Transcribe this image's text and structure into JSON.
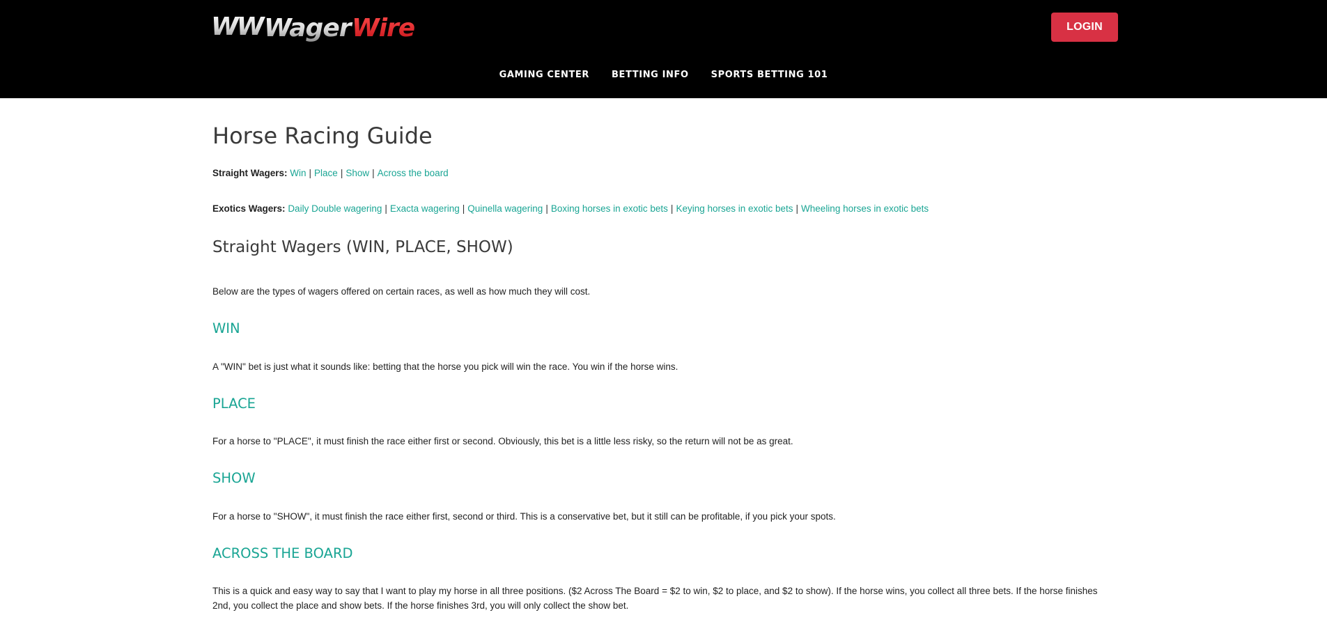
{
  "header": {
    "logo_text_wager": "Wager",
    "logo_text_wire": "Wire",
    "logo_mark": "WW",
    "login_label": "LOGIN",
    "nav": [
      {
        "label": "GAMING CENTER"
      },
      {
        "label": "BETTING INFO"
      },
      {
        "label": "SPORTS BETTING 101"
      }
    ]
  },
  "colors": {
    "header_bg": "#000000",
    "login_bg": "#d83144",
    "accent_teal": "#1aa594",
    "logo_red": "#e21d23"
  },
  "page": {
    "title": "Horse Racing Guide",
    "straight_label": "Straight Wagers:",
    "straight_links": [
      "Win",
      "Place",
      "Show",
      "Across the board"
    ],
    "exotics_label": "Exotics Wagers:",
    "exotics_links": [
      "Daily Double wagering",
      "Exacta wagering",
      "Quinella wagering",
      "Boxing horses in exotic bets",
      "Keying horses in exotic bets",
      "Wheeling horses in exotic bets"
    ],
    "section_title": "Straight Wagers (WIN, PLACE, SHOW)",
    "intro": "Below are the types of wagers offered on certain races, as well as how much they will cost.",
    "win_title": "WIN",
    "win_text": "A \"WIN\" bet is just what it sounds like: betting that the horse you pick will win the race. You win if the horse wins.",
    "place_title": "PLACE",
    "place_text": "For a horse to \"PLACE\", it must finish the race either first or second. Obviously, this bet is a little less risky, so the return will not be as great.",
    "show_title": "SHOW",
    "show_text": "For a horse to \"SHOW\", it must finish the race either first, second or third. This is a conservative bet, but it still can be profitable, if you pick your spots.",
    "atb_title": "ACROSS THE BOARD",
    "atb_text": "This is a quick and easy way to say that I want to play my horse in all three positions. ($2 Across The Board = $2 to win, $2 to place, and $2 to show). If the horse wins, you collect all three bets. If the horse finishes 2nd, you collect the place and show bets. If the horse finishes 3rd, you will only collect the show bet."
  }
}
